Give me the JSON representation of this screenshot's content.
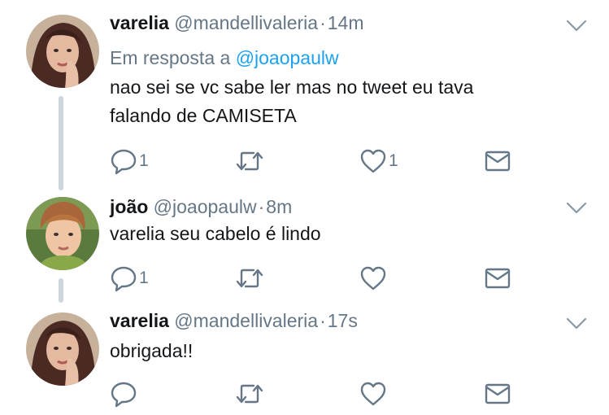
{
  "tweets": [
    {
      "name": "varelia",
      "handle": "@mandellivaleria",
      "separator": "·",
      "time": "14m",
      "reply_prefix": "Em resposta a",
      "reply_handle": "@joaopaulw",
      "text_lines": [
        "nao sei se vc sabe ler mas no tweet eu tava",
        "falando de CAMISETA"
      ],
      "reply_count": "1",
      "like_count": "1"
    },
    {
      "name": "joão",
      "handle": "@joaopaulw",
      "separator": "·",
      "time": "8m",
      "text_lines": [
        "varelia seu cabelo é lindo"
      ],
      "reply_count": "1"
    },
    {
      "name": "varelia",
      "handle": "@mandellivaleria",
      "separator": "·",
      "time": "17s",
      "text_lines": [
        "obrigada!!"
      ]
    }
  ],
  "icons": {
    "reply": "reply-icon",
    "retweet": "retweet-icon",
    "like": "heart-icon",
    "dm": "envelope-icon",
    "more": "chevron-down-icon"
  },
  "colors": {
    "text": "#14171a",
    "muted": "#657786",
    "link": "#1da1f2",
    "thread_line": "#ccd6dd"
  }
}
